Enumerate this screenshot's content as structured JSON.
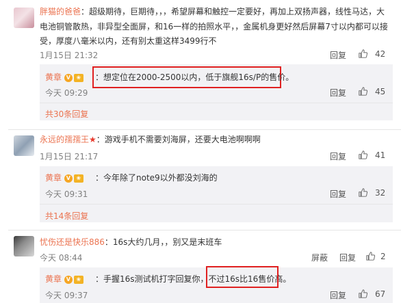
{
  "comments": [
    {
      "username": "胖猫的爸爸",
      "text_line1": "：超级期待，巨期待，，，希望屏幕和触控一定要好，再加上双扬声器，线性马达，大",
      "text_line2": "电池铜管散热，非异型全面屏，和16一样的拍照水平，，金属机身更好然后屏幕7寸以内都可以接",
      "text_line3": "受，厚度八毫米以内，还有别太重这样3499行不",
      "time": "1月15日 21:32",
      "reply_label": "回复",
      "likes": "42",
      "sub_reply": {
        "username": "黄章",
        "text": "：想定位在2000-2500以内，低于旗舰16s/P的售价。",
        "time": "今天 09:29",
        "reply_label": "回复",
        "likes": "45"
      },
      "more_replies": "共30条回复"
    },
    {
      "username": "永远的孺孺王",
      "text": "：游戏手机不需要刘海屏，还要大电池啊啊啊",
      "time": "1月15日 21:17",
      "reply_label": "回复",
      "likes": "41",
      "sub_reply": {
        "username": "黄章",
        "text": "：今年除了note9以外都没刘海的",
        "time": "今天 09:31",
        "reply_label": "回复",
        "likes": "32"
      },
      "more_replies": "共14条回复"
    },
    {
      "username": "忧伤还是快乐886",
      "text": "：16s大约几月，，别又是末班车",
      "time": "今天 08:44",
      "reply_label": "回复",
      "block_label": "屏蔽",
      "likes": "2",
      "sub_reply": {
        "username": "黄章",
        "text": "：手握16s测试机打字回复你，不过16s比16售价高。",
        "time": "今天 09:37",
        "reply_label": "回复",
        "likes": "67"
      }
    }
  ],
  "colors": {
    "name": "#eb7350",
    "highlight": "#e02020",
    "reply_bg": "#f2f2f5"
  },
  "icons": {
    "like": "thumbs-up-icon",
    "vip": "v-badge-icon"
  }
}
